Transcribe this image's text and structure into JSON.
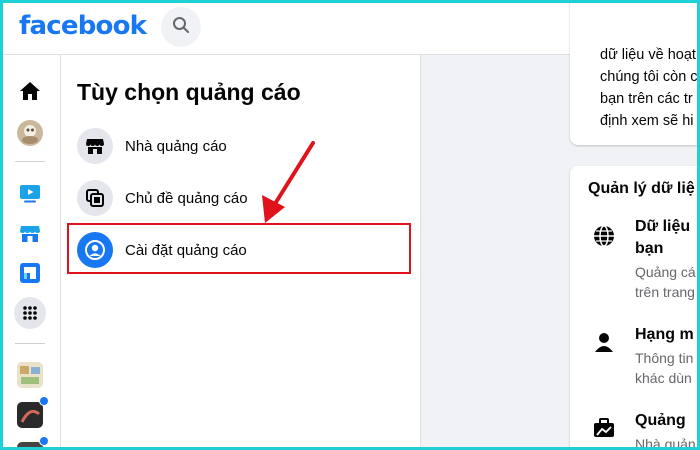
{
  "header": {
    "logo": "facebook",
    "search_icon": "search-icon"
  },
  "rail": {
    "items": [
      {
        "name": "home",
        "icon": "home-icon"
      },
      {
        "name": "profile",
        "icon": "avatar"
      },
      {
        "name": "watch",
        "icon": "video-icon"
      },
      {
        "name": "marketplace",
        "icon": "store-icon"
      },
      {
        "name": "gaming",
        "icon": "gaming-icon"
      },
      {
        "name": "menu",
        "icon": "grid-icon"
      },
      {
        "name": "group-1",
        "icon": "group-avatar"
      },
      {
        "name": "group-2",
        "icon": "group-avatar",
        "badge": true
      },
      {
        "name": "group-3",
        "icon": "group-avatar",
        "badge": true
      }
    ]
  },
  "panel": {
    "title": "Tùy chọn quảng cáo",
    "items": [
      {
        "label": "Nhà quảng cáo",
        "icon": "store-icon"
      },
      {
        "label": "Chủ đề quảng cáo",
        "icon": "topics-icon"
      },
      {
        "label": "Cài đặt quảng cáo",
        "icon": "user-circle-icon",
        "active": true
      }
    ]
  },
  "card_top": {
    "lines": [
      "dữ liệu về hoạt",
      "chúng tôi còn c",
      "bạn trên các tr",
      "định xem sẽ hi"
    ]
  },
  "card_data": {
    "title": "Quản lý dữ liệ",
    "items": [
      {
        "head": [
          "Dữ liệu",
          "bạn"
        ],
        "sub": [
          "Quảng cá",
          "trên trang"
        ],
        "icon": "globe-icon"
      },
      {
        "head": [
          "Hạng m"
        ],
        "sub": [
          "Thông tin",
          "khác dùn"
        ],
        "icon": "person-icon"
      },
      {
        "head": [
          "Quảng"
        ],
        "sub": [
          "Nhà quản"
        ],
        "icon": "briefcase-icon"
      }
    ]
  },
  "colors": {
    "brand": "#1877f2",
    "highlight": "#e0121b",
    "frame": "#1fd1d6"
  }
}
